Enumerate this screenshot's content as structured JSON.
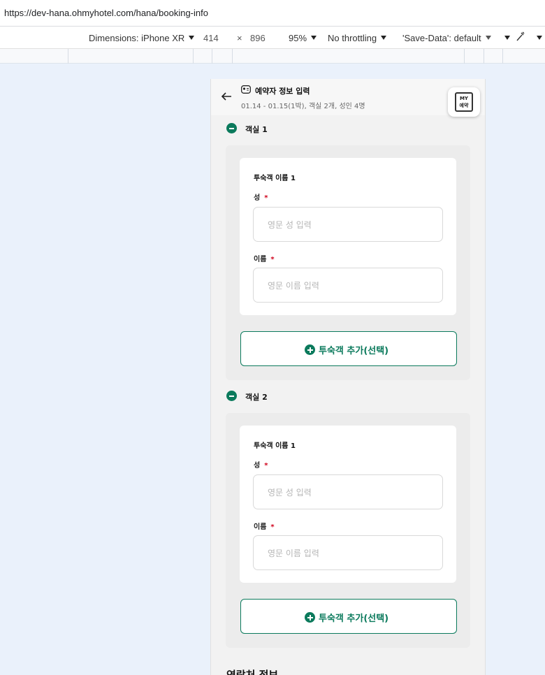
{
  "browser": {
    "url": "https://dev-hana.ohmyhotel.com/hana/booking-info"
  },
  "device_toolbar": {
    "dimensions_label": "Dimensions: iPhone XR",
    "width": "414",
    "times": "×",
    "height": "896",
    "zoom": "95%",
    "throttling": "No throttling",
    "save_data": "'Save-Data': default"
  },
  "header": {
    "title": "예약자 정보 입력",
    "subtitle": "01.14 - 01.15(1박), 객실 2개, 성인 4명",
    "my_button_line1": "MY",
    "my_button_line2": "예약"
  },
  "rooms": [
    {
      "label": "객실 1",
      "guest_title": "투숙객 이름 1",
      "last_name_label": "성",
      "last_name_placeholder": "영문 성 입력",
      "first_name_label": "이름",
      "first_name_placeholder": "영문 이름 입력",
      "required_mark": "*",
      "add_guest_label": "투숙객 추가(선택)"
    },
    {
      "label": "객실 2",
      "guest_title": "투숙객 이름 1",
      "last_name_label": "성",
      "last_name_placeholder": "영문 성 입력",
      "first_name_label": "이름",
      "first_name_placeholder": "영문 이름 입력",
      "required_mark": "*",
      "add_guest_label": "투숙객 추가(선택)"
    }
  ],
  "next_section_title": "연락처 정보",
  "colors": {
    "accent": "#0b7a5c",
    "required": "#d0021b"
  }
}
